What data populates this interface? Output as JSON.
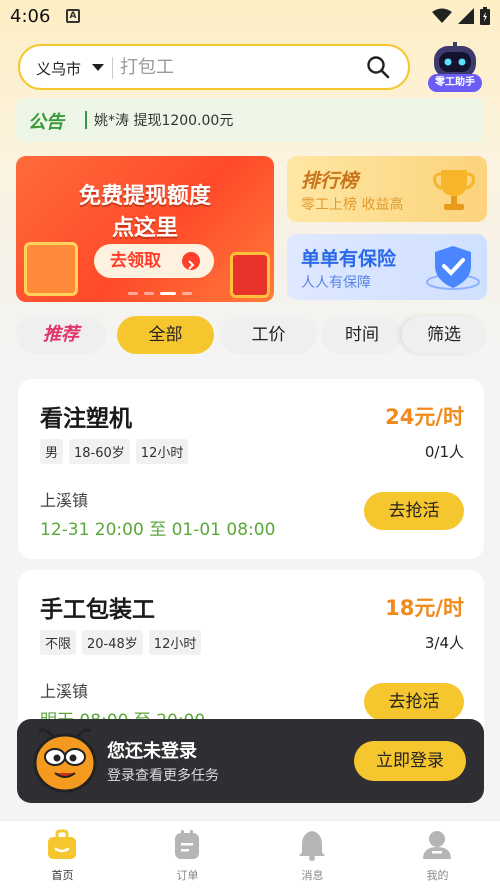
{
  "status_bar": {
    "time": "4:06",
    "notice_icon": "A"
  },
  "search": {
    "city": "义乌市",
    "placeholder": "打包工"
  },
  "assistant": {
    "label": "零工助手"
  },
  "notice": {
    "tag": "公告",
    "text": "姚*涛 提现1200.00元"
  },
  "banner_main": {
    "line1": "免费提现额度",
    "line2": "点这里",
    "button": "去领取"
  },
  "banner_rank": {
    "title": "排行榜",
    "subtitle": "零工上榜 收益高"
  },
  "banner_insurance": {
    "title": "单单有保险",
    "subtitle": "人人有保障"
  },
  "tabs": [
    {
      "label": "推荐"
    },
    {
      "label": "全部"
    },
    {
      "label": "工价"
    },
    {
      "label": "时间"
    },
    {
      "label": "筛选"
    }
  ],
  "jobs": [
    {
      "title": "看注塑机",
      "price": "24元/时",
      "count": "0/1人",
      "tags": [
        "男",
        "18-60岁",
        "12小时"
      ],
      "location": "上溪镇",
      "time": "12-31 20:00 至 01-01 08:00",
      "button": "去抢活"
    },
    {
      "title": "手工包装工",
      "price": "18元/时",
      "count": "3/4人",
      "tags": [
        "不限",
        "20-48岁",
        "12小时"
      ],
      "location": "上溪镇",
      "time": "明天 08:00 至 20:00",
      "button": "去抢活"
    }
  ],
  "login_toast": {
    "title": "您还未登录",
    "subtitle": "登录查看更多任务",
    "button": "立即登录"
  },
  "bottom_nav": [
    {
      "label": "首页",
      "icon": "home-briefcase-icon"
    },
    {
      "label": "订单",
      "icon": "order-icon"
    },
    {
      "label": "消息",
      "icon": "bell-icon"
    },
    {
      "label": "我的",
      "icon": "profile-icon"
    }
  ],
  "colors": {
    "accent": "#f6c62e",
    "price": "#f08a1c",
    "time_green": "#5aa83a",
    "notice_green": "#3a9a3a"
  }
}
